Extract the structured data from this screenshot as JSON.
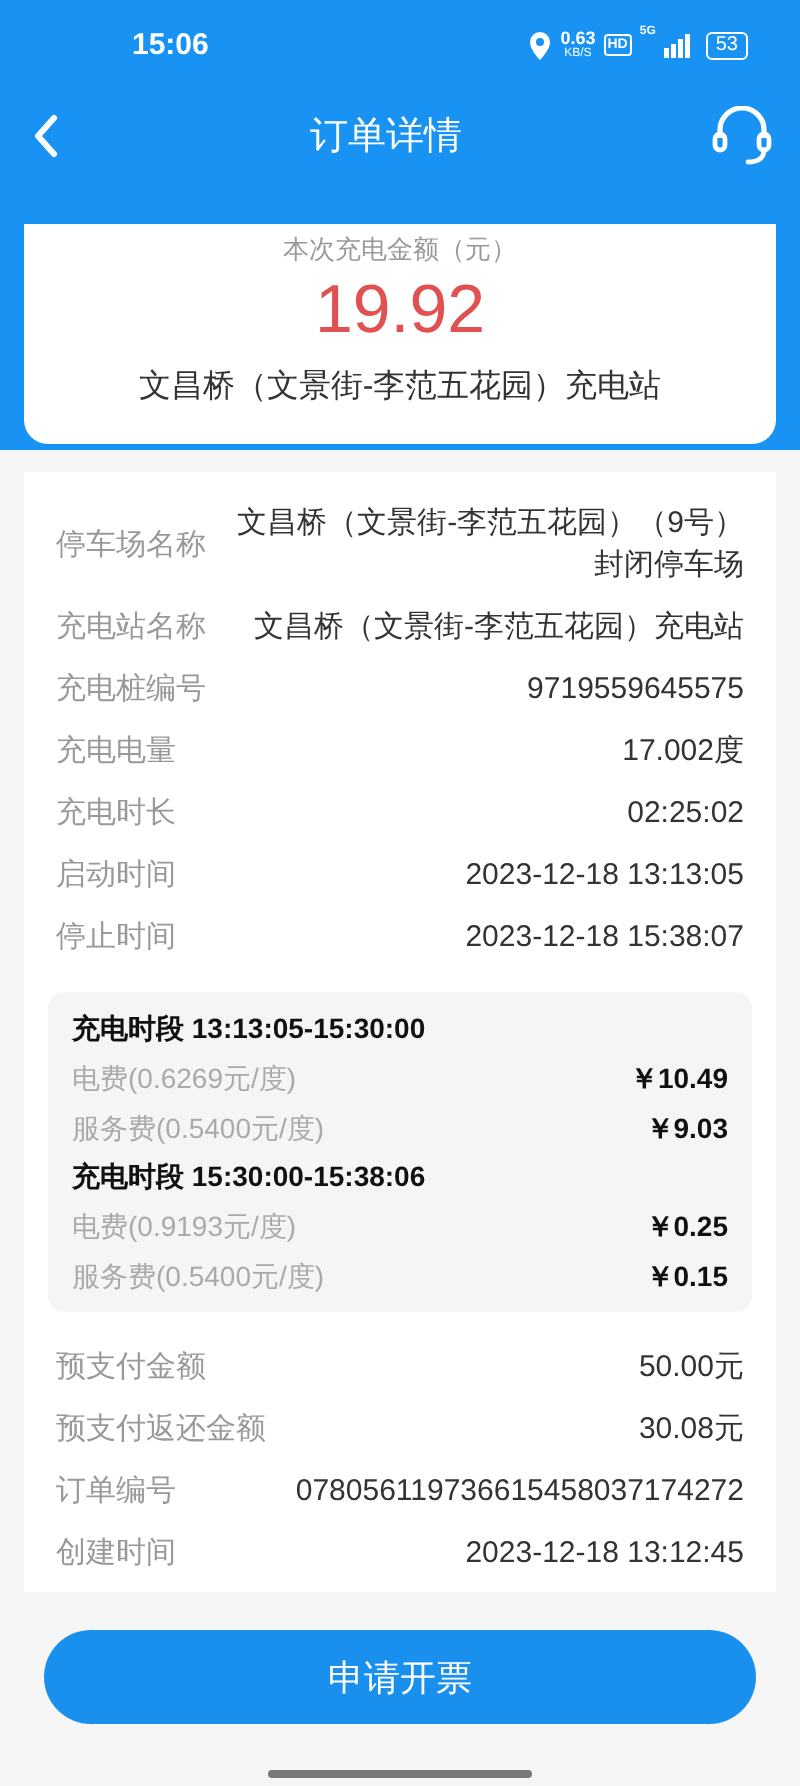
{
  "status_bar": {
    "time": "15:06",
    "net_speed": "0.63",
    "net_unit": "KB/S",
    "hd": "HD",
    "network": "5G",
    "battery": "53"
  },
  "header": {
    "title": "订单详情"
  },
  "summary": {
    "label": "本次充电金额（元）",
    "amount": "19.92",
    "station": "文昌桥（文景街-李范五花园）充电站"
  },
  "details": [
    {
      "label": "停车场名称",
      "value": "文昌桥（文景街-李范五花园）（9号）封闭停车场"
    },
    {
      "label": "充电站名称",
      "value": "文昌桥（文景街-李范五花园）充电站"
    },
    {
      "label": "充电桩编号",
      "value": "9719559645575"
    },
    {
      "label": "充电电量",
      "value": "17.002度"
    },
    {
      "label": "充电时长",
      "value": "02:25:02"
    },
    {
      "label": "启动时间",
      "value": "2023-12-18 13:13:05"
    },
    {
      "label": "停止时间",
      "value": "2023-12-18 15:38:07"
    }
  ],
  "segments": [
    {
      "title": "充电时段 13:13:05-15:30:00",
      "fees": [
        {
          "label": "电费(0.6269元/度)",
          "amount": "￥10.49"
        },
        {
          "label": "服务费(0.5400元/度)",
          "amount": "￥9.03"
        }
      ]
    },
    {
      "title": "充电时段 15:30:00-15:38:06",
      "fees": [
        {
          "label": "电费(0.9193元/度)",
          "amount": "￥0.25"
        },
        {
          "label": "服务费(0.5400元/度)",
          "amount": "￥0.15"
        }
      ]
    }
  ],
  "payment": [
    {
      "label": "预支付金额",
      "value": "50.00元"
    },
    {
      "label": "预支付返还金额",
      "value": "30.08元"
    },
    {
      "label": "订单编号",
      "value": "078056119736615458037174272"
    },
    {
      "label": "创建时间",
      "value": "2023-12-18 13:12:45"
    }
  ],
  "button": {
    "label": "申请开票"
  }
}
